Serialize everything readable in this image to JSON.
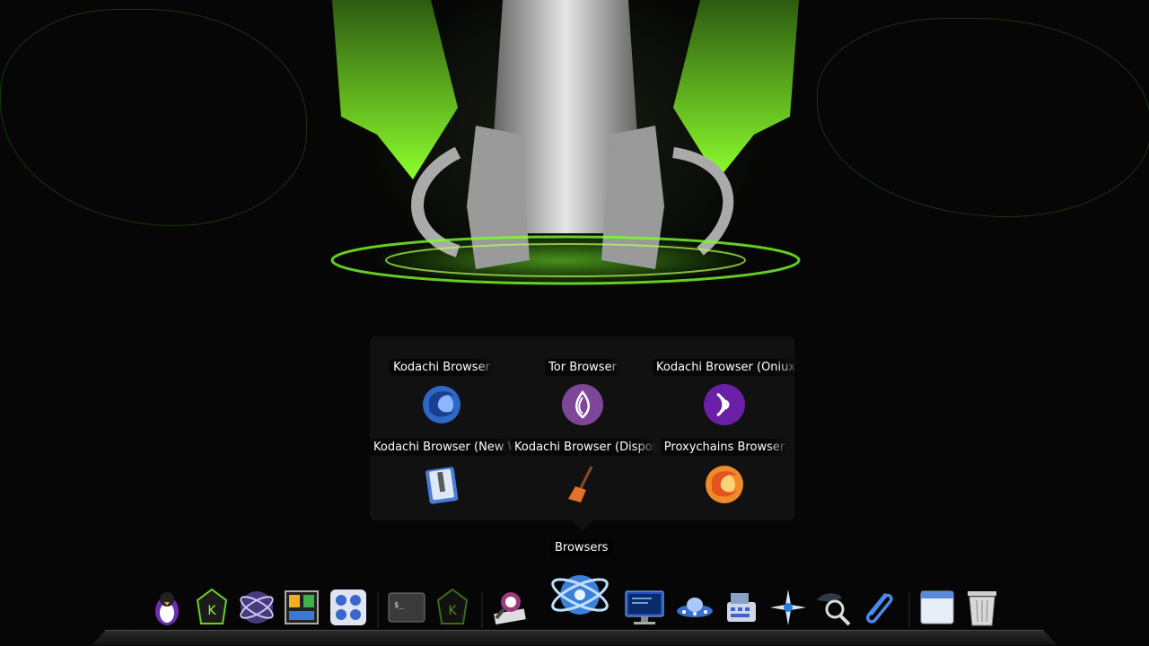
{
  "popup": {
    "stack_label": "Browsers",
    "items": [
      {
        "label": "Kodachi Browser",
        "icon": "firefox-blue-icon"
      },
      {
        "label": "Tor Browser",
        "icon": "tor-onion-icon"
      },
      {
        "label": "Kodachi Browser (Oniux)",
        "icon": "oniux-icon"
      },
      {
        "label": "Kodachi Browser (New Window)",
        "icon": "zip-archive-icon"
      },
      {
        "label": "Kodachi Browser (Disposable)",
        "icon": "broom-icon"
      },
      {
        "label": "Proxychains Browser",
        "icon": "firefox-orange-icon"
      }
    ]
  },
  "dock": {
    "items": [
      {
        "icon": "penguin-icon"
      },
      {
        "icon": "kodachi-logo-icon"
      },
      {
        "icon": "orbit-sphere-icon"
      },
      {
        "icon": "window-manager-icon"
      },
      {
        "icon": "control-dials-icon"
      },
      {
        "icon": "terminal-icon",
        "text": "$_"
      },
      {
        "icon": "kodachi-dark-logo-icon"
      },
      {
        "icon": "spy-magnifier-icon"
      },
      {
        "icon": "browsers-atom-icon"
      },
      {
        "icon": "network-monitor-icon"
      },
      {
        "icon": "ufo-icon"
      },
      {
        "icon": "cash-register-icon"
      },
      {
        "icon": "star-tools-icon"
      },
      {
        "icon": "search-spy-icon"
      },
      {
        "icon": "paperclip-icon"
      },
      {
        "icon": "window-frame-icon"
      },
      {
        "icon": "trash-icon"
      }
    ]
  },
  "colors": {
    "accent_green": "#7cff2a",
    "tor_purple": "#7d4698"
  }
}
